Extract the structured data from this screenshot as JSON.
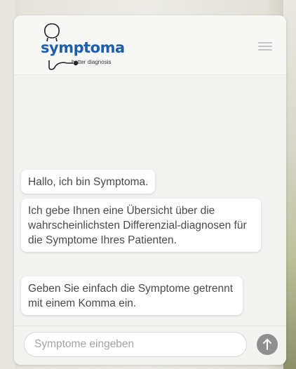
{
  "app": {
    "brand": "symptoma",
    "tagline": "better diagnosis"
  },
  "header": {
    "menu_icon": "hamburger-menu-icon"
  },
  "messages": [
    {
      "text": "Hallo, ich bin Symptoma."
    },
    {
      "text": "Ich gebe Ihnen eine Übersicht über die wahrscheinlichsten Differenzial-diagnosen für die Symptome Ihres Patienten."
    },
    {
      "text": "Geben Sie einfach die Symptome getrennt mit einem Komma ein."
    }
  ],
  "composer": {
    "placeholder": "Symptome eingeben",
    "value": "",
    "send_icon": "arrow-up-icon"
  },
  "colors": {
    "brand": "#1f5fa8",
    "send_button": "#8f8f8f",
    "bubble_text": "#4a4a4a"
  }
}
